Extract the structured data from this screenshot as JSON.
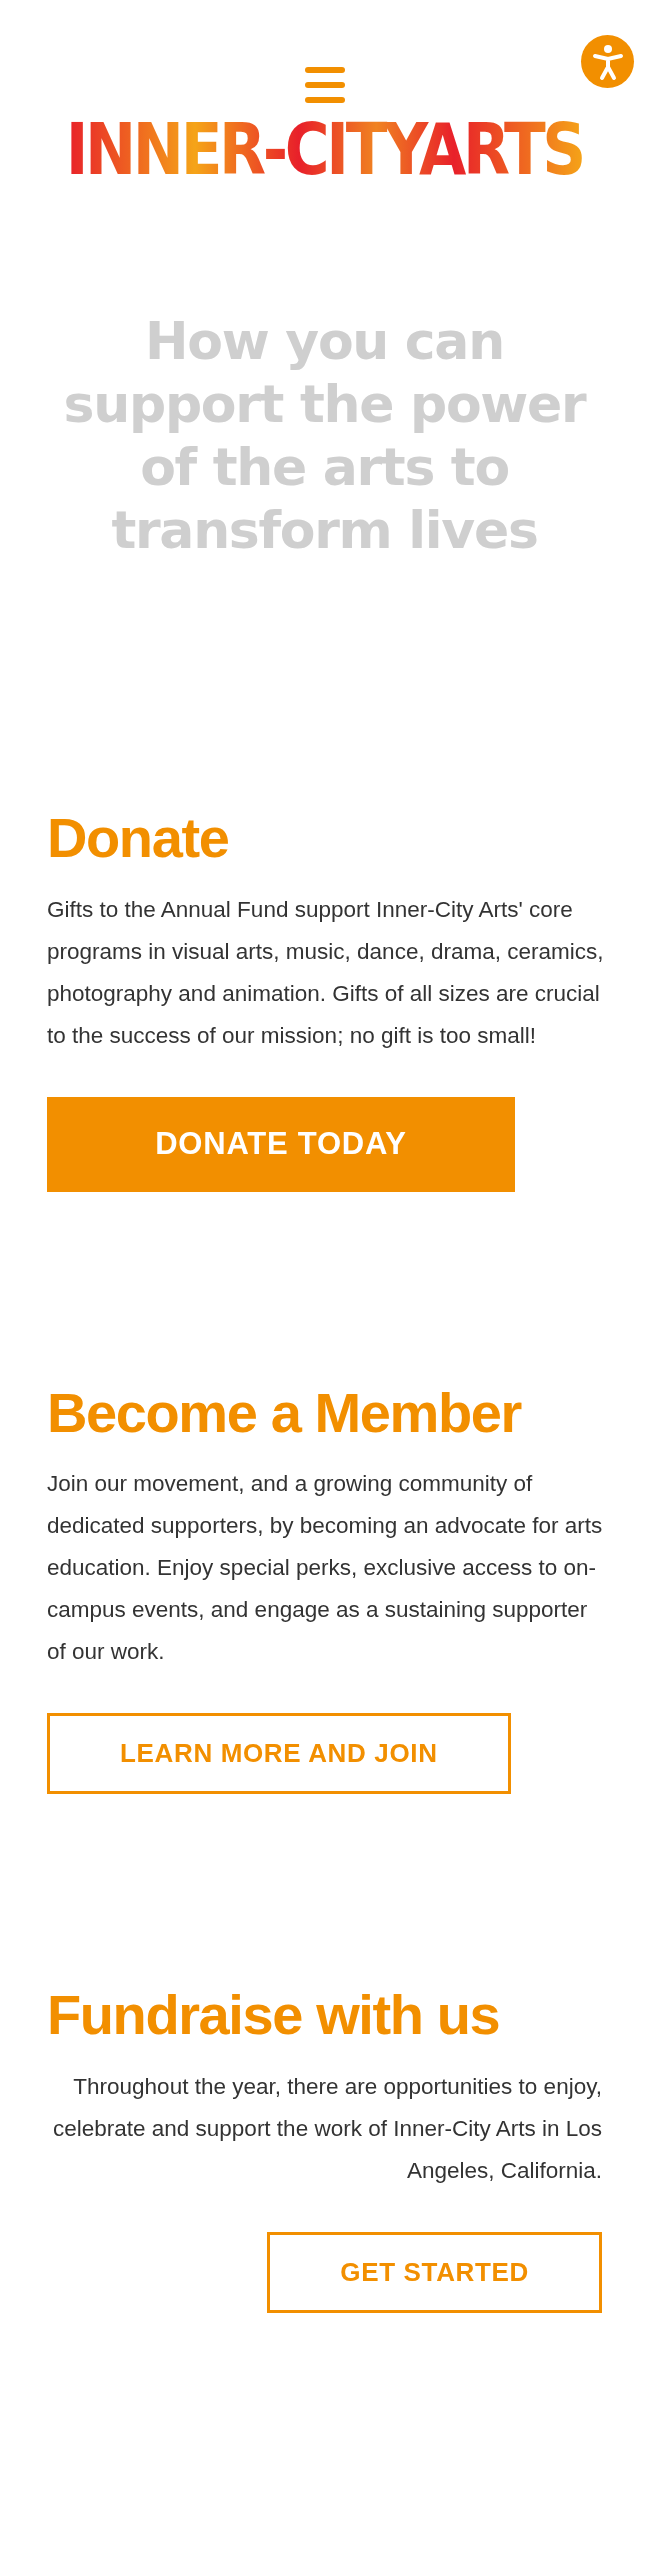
{
  "header": {
    "logo": "INNER-CITYARTS"
  },
  "hero": {
    "title": "How you can support the power of the arts to transform lives"
  },
  "sections": [
    {
      "title": "Donate",
      "text": "Gifts to the Annual Fund support Inner-City Arts' core programs in visual arts, music, dance, drama, ceramics, photography and animation. Gifts of all sizes are crucial to the success of our mission; no gift is too small!",
      "kind": "left",
      "button": {
        "label": "DONATE TODAY",
        "kind": "filled"
      }
    },
    {
      "title": "Become a Member",
      "text": "Join our movement, and a growing community of dedicated supporters, by becoming an advocate for arts education. Enjoy special perks, exclusive access to on-campus events, and engage as a sustaining supporter of our work.",
      "kind": "left",
      "button": {
        "label": "LEARN MORE AND JOIN",
        "kind": "outline"
      }
    },
    {
      "title": "Fundraise with us",
      "text": "Throughout the year, there are opportunities to enjoy, celebrate and support the work of Inner-City Arts in Los Angeles, California.",
      "kind": "right",
      "button": {
        "label": "GET STARTED",
        "kind": "outline"
      }
    }
  ]
}
